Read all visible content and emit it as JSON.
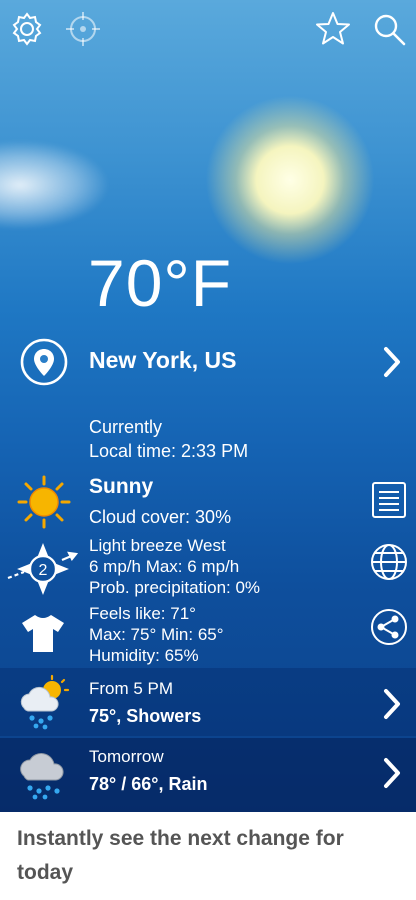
{
  "current": {
    "temperature": "70°F",
    "location": "New York, US",
    "heading": "Currently",
    "local_time": "Local time: 2:33 PM",
    "condition": "Sunny",
    "cloud_cover": "Cloud cover: 30%",
    "wind": "Light breeze West",
    "wind_speed": "6 mp/h Max: 6 mp/h",
    "precipitation": "Prob. precipitation: 0%",
    "wind_force": "2",
    "feels_like": "Feels like: 71°",
    "max_min": "Max: 75°  Min: 65°",
    "humidity": "Humidity: 65%"
  },
  "next_change": {
    "time": "From 5 PM",
    "summary": "75°, Showers"
  },
  "tomorrow": {
    "label": "Tomorrow",
    "summary": "78° / 66°, Rain"
  },
  "caption": "Instantly see the next change for today",
  "colors": {
    "accent_text": "#ffffff",
    "caption_text": "#555555",
    "sun": "#f5b800"
  }
}
